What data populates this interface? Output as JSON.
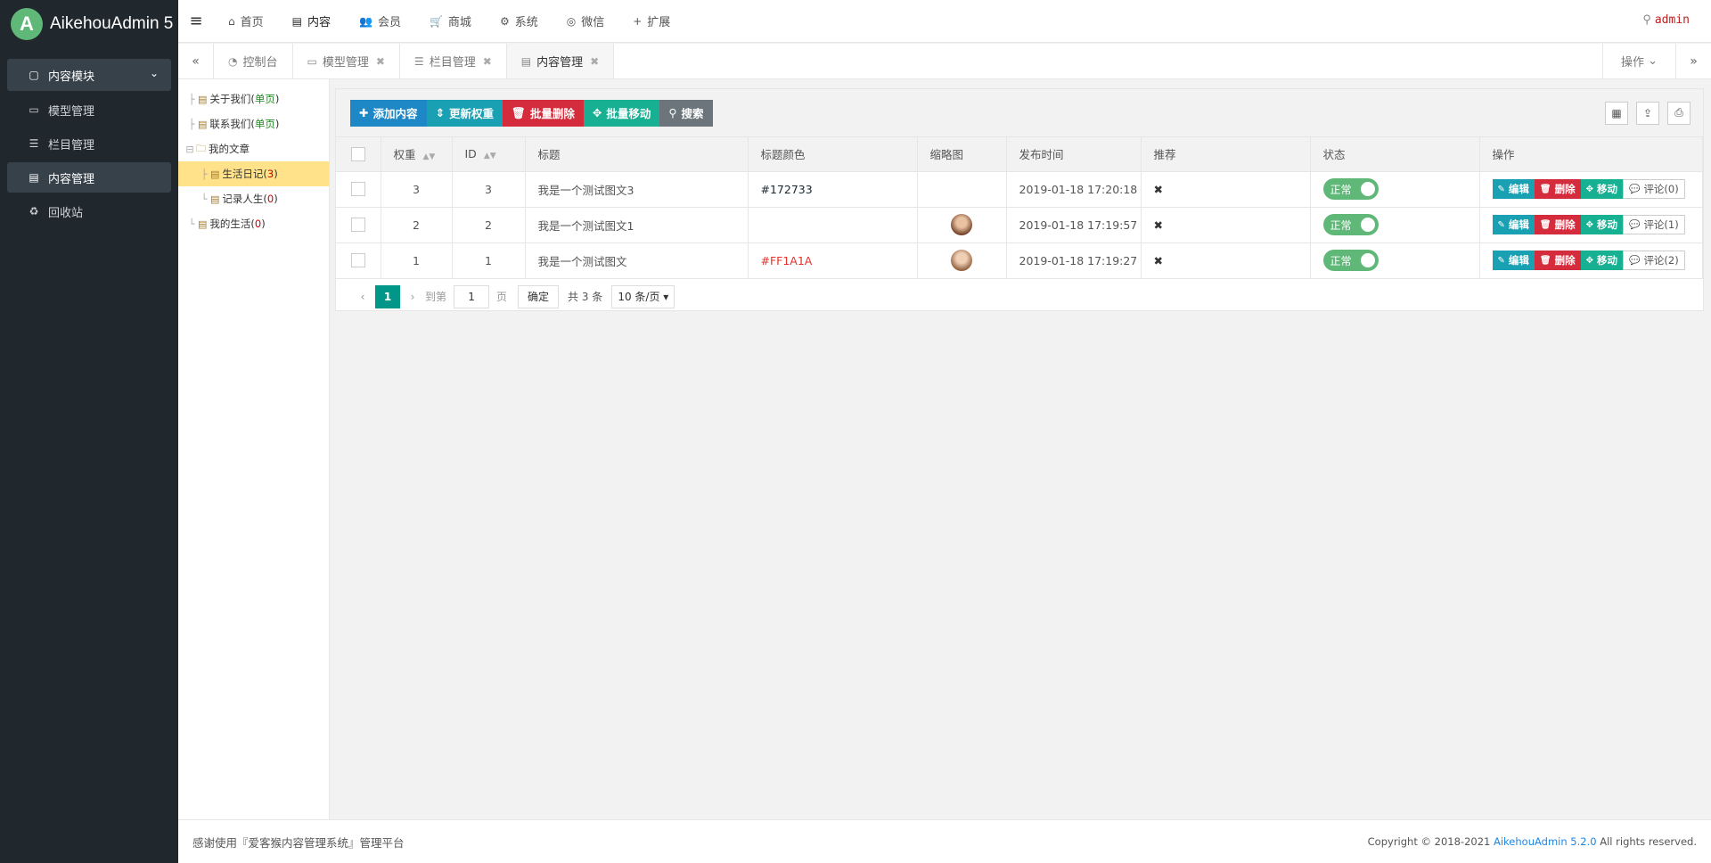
{
  "app": {
    "logo_letter": "A",
    "title": "AikehouAdmin 5"
  },
  "sidebar": {
    "group": {
      "icon": "folder-icon",
      "label": "内容模块",
      "chevron": "⌄"
    },
    "items": [
      {
        "icon": "laptop-icon",
        "label": "模型管理"
      },
      {
        "icon": "list-icon",
        "label": "栏目管理"
      },
      {
        "icon": "document-icon",
        "label": "内容管理",
        "active": true
      },
      {
        "icon": "recycle-icon",
        "label": "回收站"
      }
    ]
  },
  "topnav": {
    "items": [
      {
        "icon": "home-icon",
        "label": "首页"
      },
      {
        "icon": "document-icon",
        "label": "内容",
        "active": true
      },
      {
        "icon": "users-icon",
        "label": "会员"
      },
      {
        "icon": "cart-icon",
        "label": "商城"
      },
      {
        "icon": "gears-icon",
        "label": "系统"
      },
      {
        "icon": "wechat-icon",
        "label": "微信"
      },
      {
        "icon": "plus-icon",
        "label": "扩展"
      }
    ],
    "user": "admin"
  },
  "tabs": {
    "items": [
      {
        "icon": "dashboard-icon",
        "label": "控制台",
        "closable": false
      },
      {
        "icon": "laptop-icon",
        "label": "模型管理",
        "closable": true
      },
      {
        "icon": "list-icon",
        "label": "栏目管理",
        "closable": true
      },
      {
        "icon": "document-icon",
        "label": "内容管理",
        "closable": true,
        "active": true
      }
    ],
    "operations_label": "操作"
  },
  "tree": {
    "nodes": [
      {
        "label": "关于我们",
        "count": "单页",
        "count_color": "green",
        "level": 0
      },
      {
        "label": "联系我们",
        "count": "单页",
        "count_color": "green",
        "level": 0
      },
      {
        "label": "我的文章",
        "count": "",
        "level": 0,
        "folder": true
      },
      {
        "label": "生活日记",
        "count": "3",
        "count_color": "red",
        "level": 1,
        "selected": true
      },
      {
        "label": "记录人生",
        "count": "0",
        "count_color": "red",
        "level": 1
      },
      {
        "label": "我的生活",
        "count": "0",
        "count_color": "red",
        "level": 0
      }
    ]
  },
  "toolbar": {
    "add": "添加内容",
    "update_weight": "更新权重",
    "batch_delete": "批量删除",
    "batch_move": "批量移动",
    "search": "搜索"
  },
  "table": {
    "headers": [
      "权重",
      "ID",
      "标题",
      "标题颜色",
      "缩略图",
      "发布时间",
      "推荐",
      "状态",
      "操作"
    ],
    "rows": [
      {
        "weight": "3",
        "id": "3",
        "title": "我是一个测试图文3",
        "color": "#172733",
        "color_red": false,
        "thumb": false,
        "time": "2019-01-18 17:20:18",
        "status": "正常",
        "comments": "评论(0)"
      },
      {
        "weight": "2",
        "id": "2",
        "title": "我是一个测试图文1",
        "color": "",
        "color_red": false,
        "thumb": true,
        "time": "2019-01-18 17:19:57",
        "status": "正常",
        "comments": "评论(1)"
      },
      {
        "weight": "1",
        "id": "1",
        "title": "我是一个测试图文",
        "color": "#FF1A1A",
        "color_red": true,
        "thumb": true,
        "time": "2019-01-18 17:19:27",
        "status": "正常",
        "comments": "评论(2)"
      }
    ],
    "op_labels": {
      "edit": "编辑",
      "delete": "删除",
      "move": "移动"
    },
    "recommend_mark": "✖"
  },
  "pager": {
    "current": "1",
    "goto_label": "到第",
    "goto_value": "1",
    "page_unit": "页",
    "confirm": "确定",
    "total": "共 3 条",
    "per_page": "10 条/页"
  },
  "footer": {
    "left": "感谢使用『爱客猴内容管理系统』管理平台",
    "copyright_pre": "Copyright © 2018-2021 ",
    "copyright_link": "AikehouAdmin 5.2.0",
    "copyright_post": " All rights reserved."
  }
}
